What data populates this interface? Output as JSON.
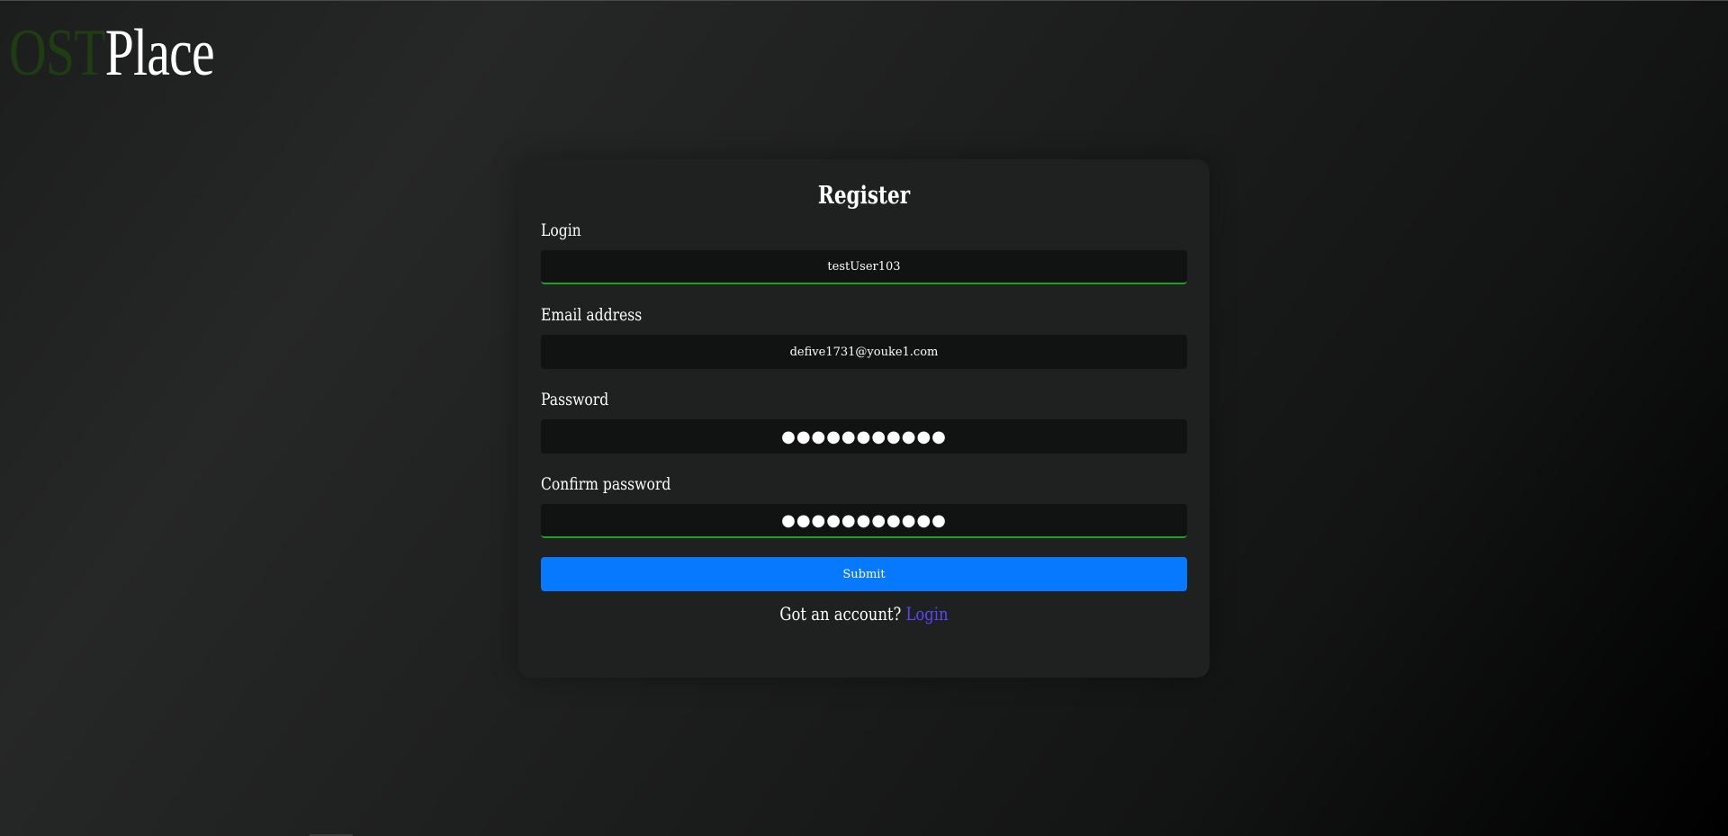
{
  "logo": {
    "part1": "OST",
    "part2": "Place"
  },
  "form": {
    "title": "Register",
    "fields": [
      {
        "label": "Login",
        "value": "testUser103",
        "type": "text",
        "state": "valid"
      },
      {
        "label": "Email address",
        "value": "defive1731@youke1.com",
        "type": "email",
        "state": "none"
      },
      {
        "label": "Password",
        "value": "●●●●●●●●●●●",
        "type": "password",
        "state": "none"
      },
      {
        "label": "Confirm password",
        "value": "●●●●●●●●●●●",
        "type": "password",
        "state": "valid"
      }
    ],
    "submit_label": "Submit",
    "account_prompt": "Got an account?",
    "login_link": "Login"
  },
  "colors": {
    "accent_button": "#0779fe",
    "valid_border": "#1fa01f",
    "link": "#5b46ff",
    "logo_dark": "#1f3d12"
  }
}
